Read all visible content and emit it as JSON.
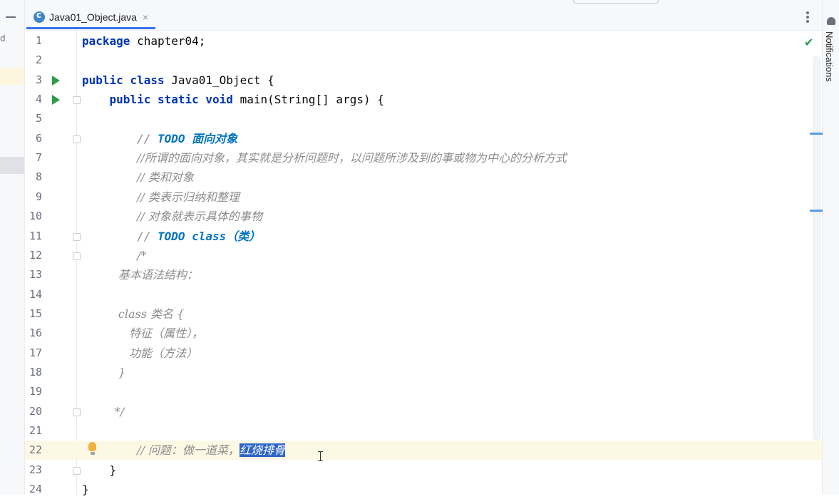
{
  "tab": {
    "icon": "java-class-icon",
    "title": "Java01_Object.java",
    "close": "×"
  },
  "notifications": {
    "label": "Notifications",
    "icon": "bell-icon"
  },
  "left_strip": {
    "glyph": "d"
  },
  "status": {
    "icon": "checkmark-icon",
    "glyph": "✔"
  },
  "colors": {
    "keyword": "#0033b3",
    "comment": "#8c8c8c",
    "todo": "#0073bf",
    "selection": "#2f65ca",
    "current_line": "#fdf8e4",
    "run": "#2e9c4a"
  },
  "editor": {
    "current_line": 22,
    "lines": [
      {
        "n": "1",
        "code": "package chapter04;"
      },
      {
        "n": "2",
        "code": ""
      },
      {
        "n": "3",
        "code": "public class Java01_Object {",
        "run": true
      },
      {
        "n": "4",
        "code": "    public static void main(String[] args) {",
        "run": true,
        "fold": true
      },
      {
        "n": "5",
        "code": ""
      },
      {
        "n": "6",
        "code": "        // TODO 面向对象",
        "fold": true
      },
      {
        "n": "7",
        "code": "        //所谓的面向对象，其实就是分析问题时，以问题所涉及到的事或物为中心的分析方式"
      },
      {
        "n": "8",
        "code": "        // 类和对象"
      },
      {
        "n": "9",
        "code": "        // 类表示归纳和整理"
      },
      {
        "n": "10",
        "code": "        // 对象就表示具体的事物"
      },
      {
        "n": "11",
        "code": "        // TODO class（类）",
        "fold": true
      },
      {
        "n": "12",
        "code": "        /*",
        "fold": true
      },
      {
        "n": "13",
        "code": "          基本语法结构："
      },
      {
        "n": "14",
        "code": ""
      },
      {
        "n": "15",
        "code": "          class 类名 {"
      },
      {
        "n": "16",
        "code": "             特征（属性），"
      },
      {
        "n": "17",
        "code": "             功能（方法）"
      },
      {
        "n": "18",
        "code": "          }"
      },
      {
        "n": "19",
        "code": ""
      },
      {
        "n": "20",
        "code": "         */",
        "fold": true
      },
      {
        "n": "21",
        "code": ""
      },
      {
        "n": "22",
        "code": "        // 问题：做一道菜，",
        "selected": "红烧排骨",
        "bulb": true
      },
      {
        "n": "23",
        "code": "    }",
        "fold": true
      },
      {
        "n": "24",
        "code": "}"
      }
    ]
  }
}
